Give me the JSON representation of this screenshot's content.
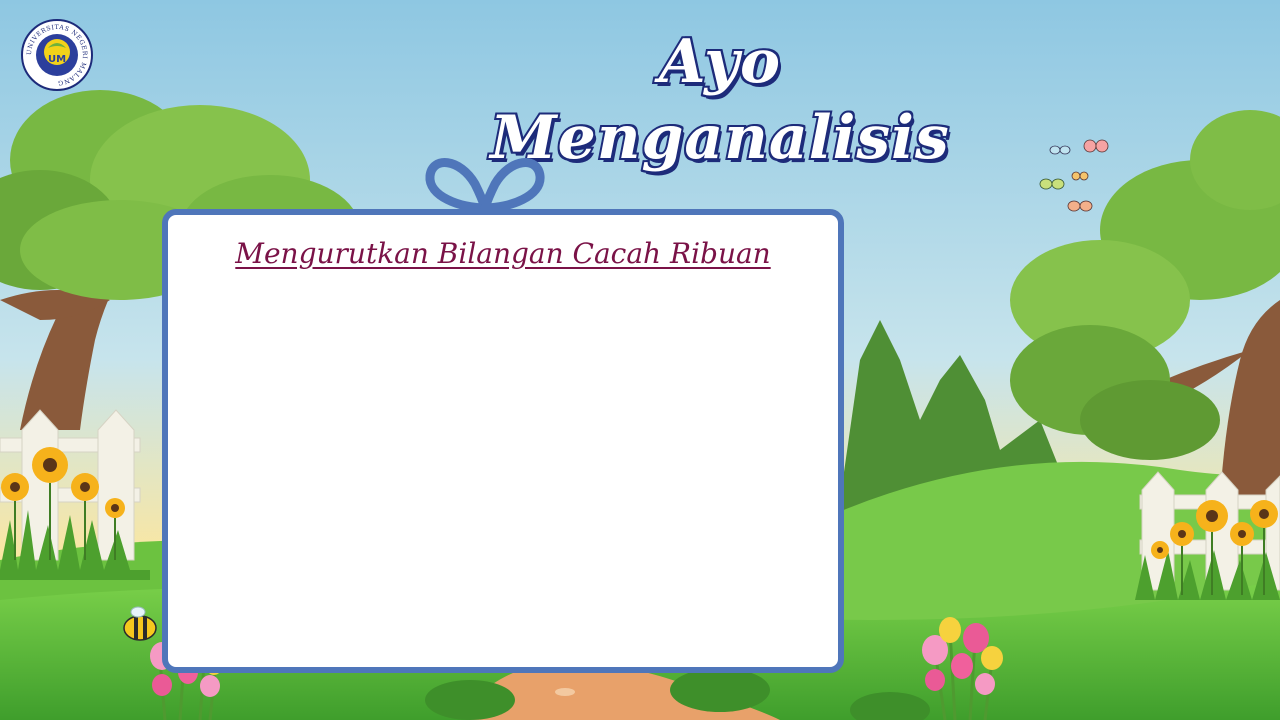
{
  "header": {
    "title": "Ayo Menganalisis"
  },
  "logo": {
    "icon": "university-emblem",
    "ring_text": "UNIVERSITAS NEGERI MALANG",
    "monogram": "UM"
  },
  "board": {
    "heading": "Mengurutkan Bilangan Cacah Ribuan"
  },
  "colors": {
    "title_stroke": "#1d2b7a",
    "board_border": "#4f76ba",
    "heading": "#7a1247",
    "sky_top": "#8ec7e2",
    "sky_bottom": "#fbe7a0",
    "grass": "#5db838"
  }
}
